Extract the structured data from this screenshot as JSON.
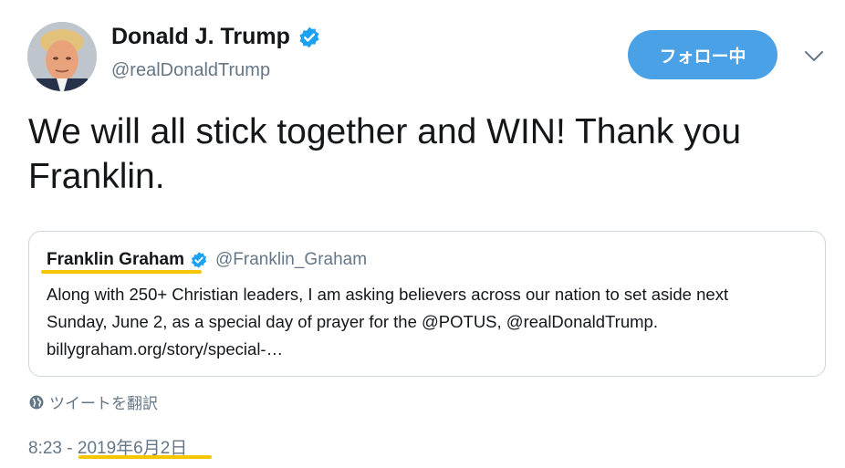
{
  "author": {
    "name": "Donald J. Trump",
    "handle": "@realDonaldTrump",
    "verified_color": "#1da1f2"
  },
  "follow_button": {
    "label": "フォロー中",
    "color": "#4aa1e6"
  },
  "menu": {
    "icon": "chevron-down-icon"
  },
  "tweet": {
    "text": "We will all stick together and WIN! Thank you Franklin."
  },
  "quoted_tweet": {
    "name": "Franklin Graham",
    "handle": "@Franklin_Graham",
    "text": "Along with 250+ Christian leaders, I am asking believers across our nation to set aside next Sunday, June 2, as a special day of prayer for the @POTUS, @realDonaldTrump. billygraham.org/story/special-…"
  },
  "translate": {
    "icon": "globe-icon",
    "label": "ツイートを翻訳"
  },
  "timestamp": {
    "time": "8:23",
    "separator": " - ",
    "date": "2019年6月2日"
  },
  "highlight_color": "#f7c600"
}
